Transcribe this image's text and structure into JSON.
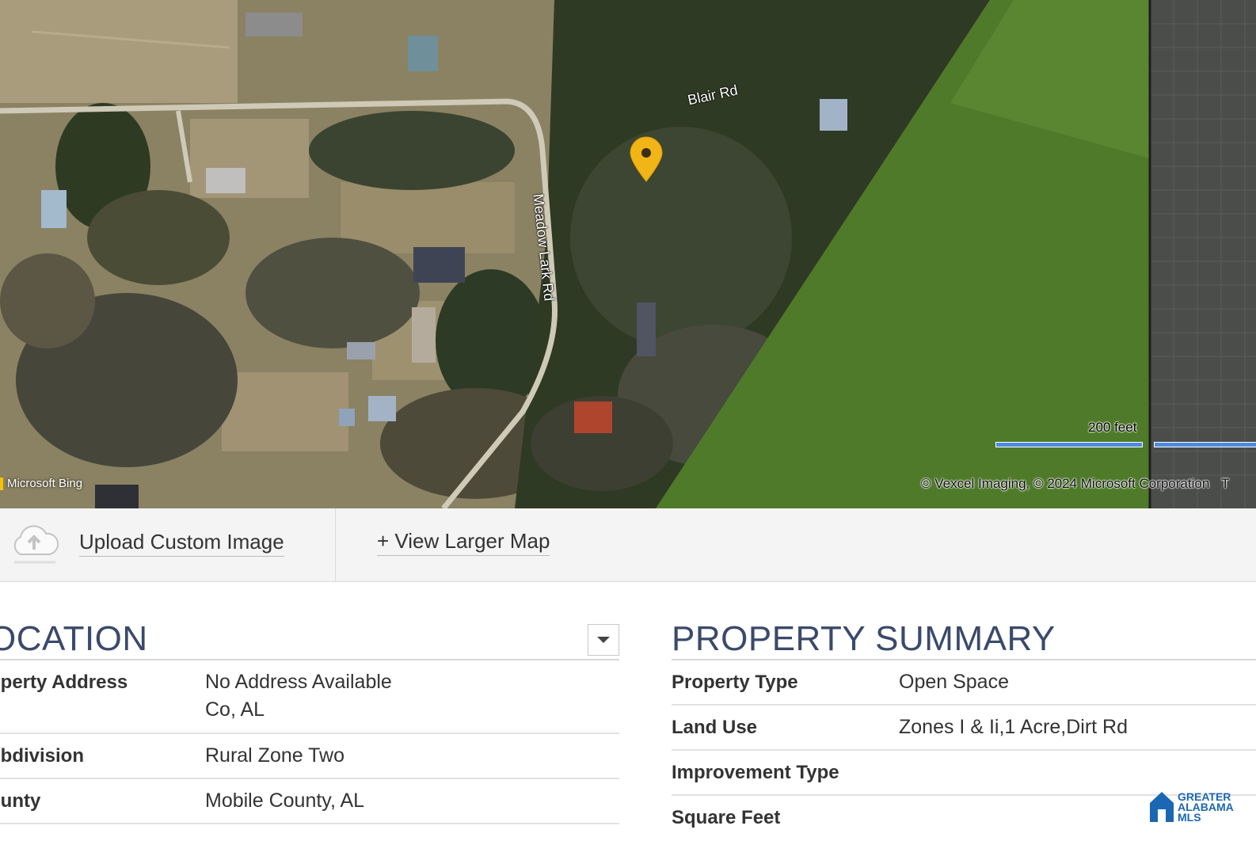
{
  "map": {
    "roads": [
      "Blair Rd",
      "Meadow Lark Rd"
    ],
    "scale_label": "200 feet",
    "copyright": "© Vexcel Imaging, © 2024 Microsoft Corporation",
    "copyright_tail": "T",
    "provider": "Microsoft Bing",
    "pin_color": "#f2b517"
  },
  "actions": {
    "upload_label": "Upload Custom Image",
    "view_larger_label": "+ View Larger Map"
  },
  "location": {
    "title": "OCATION",
    "rows": [
      {
        "label": "operty Address",
        "value_line1": "No Address Available",
        "value_line2": "Co, AL"
      },
      {
        "label": "ubdivision",
        "value": "Rural Zone Two"
      },
      {
        "label": "ounty",
        "value": "Mobile County, AL"
      }
    ]
  },
  "summary": {
    "title": "PROPERTY SUMMARY",
    "rows": [
      {
        "label": "Property Type",
        "value": "Open Space"
      },
      {
        "label": "Land Use",
        "value": "Zones I & Ii,1 Acre,Dirt Rd"
      },
      {
        "label": "Improvement Type",
        "value": ""
      },
      {
        "label": "Square Feet",
        "value": ""
      }
    ]
  },
  "logo": {
    "line1": "GREATER",
    "line2": "ALABAMA",
    "line3": "MLS",
    "color": "#1b67b3"
  },
  "colors": {
    "heading": "#3a4a6b",
    "field": "#4f7a2a",
    "forest": "#2f3a22"
  }
}
